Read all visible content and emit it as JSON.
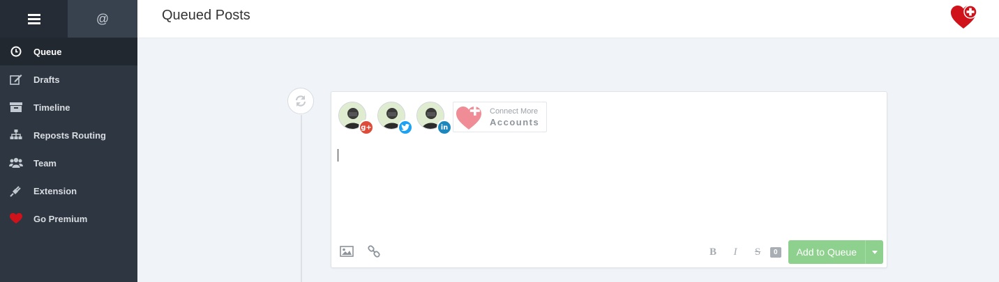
{
  "sidebar": {
    "top_tabs": {
      "menu_icon": "hamburger-icon",
      "mentions_label": "@"
    },
    "items": [
      {
        "label": "Queue",
        "icon": "clock-icon",
        "active": true
      },
      {
        "label": "Drafts",
        "icon": "edit-icon"
      },
      {
        "label": "Timeline",
        "icon": "archive-icon"
      },
      {
        "label": "Reposts Routing",
        "icon": "sitemap-icon"
      },
      {
        "label": "Team",
        "icon": "users-icon"
      },
      {
        "label": "Extension",
        "icon": "plug-icon"
      },
      {
        "label": "Go Premium",
        "icon": "heart-icon"
      }
    ]
  },
  "header": {
    "title": "Queued Posts",
    "logo_icon": "heart-plus-logo"
  },
  "composer": {
    "accounts": [
      {
        "network": "google-plus",
        "badge": "g+"
      },
      {
        "network": "twitter",
        "badge": ""
      },
      {
        "network": "linkedin",
        "badge": "in"
      }
    ],
    "connect": {
      "line1": "Connect More",
      "line2": "Accounts"
    },
    "text_value": "",
    "toolbar": {
      "bold_label": "B",
      "italic_label": "I",
      "strike_label": "S",
      "char_count": "0",
      "add_button_label": "Add to Queue"
    }
  },
  "colors": {
    "sidebar_bg": "#2e3641",
    "accent_green": "#8ed18e",
    "brand_red": "#d0121b"
  }
}
